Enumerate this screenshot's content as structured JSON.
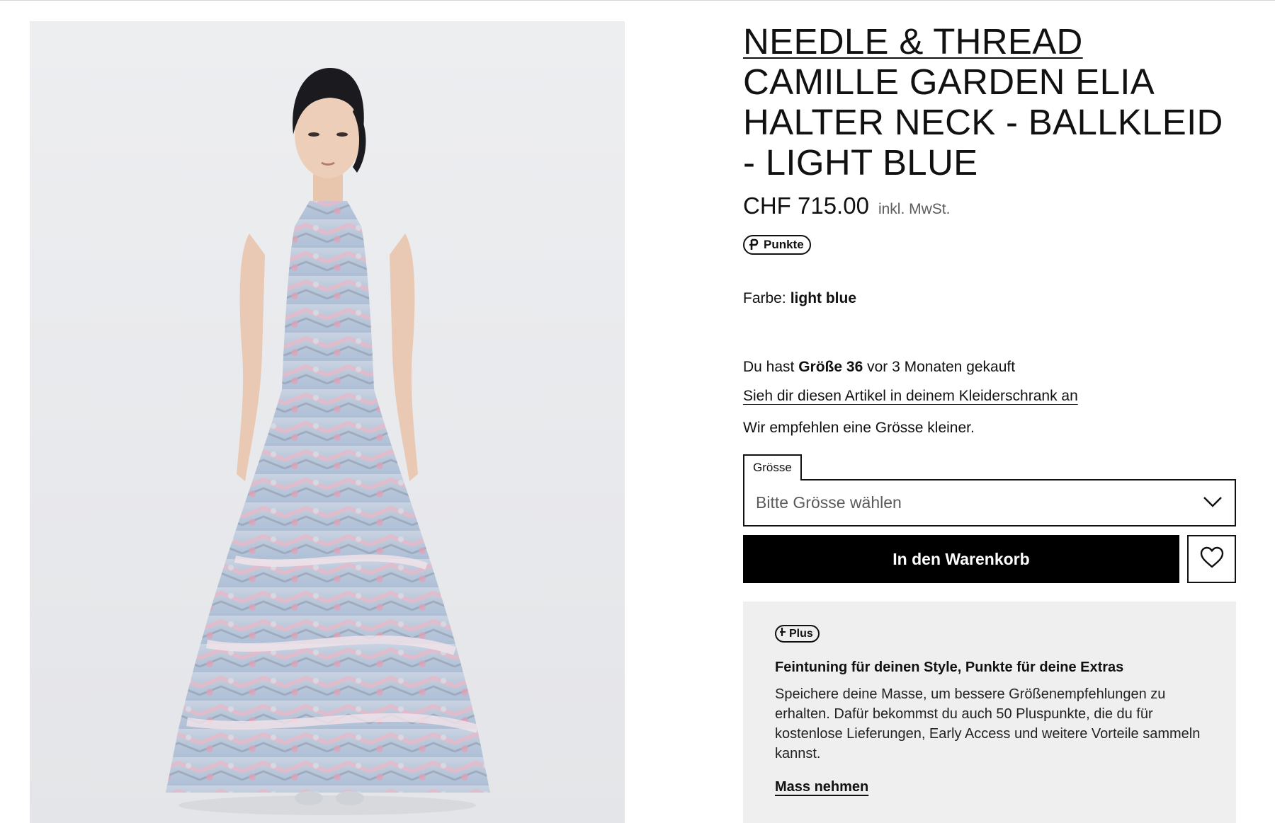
{
  "product": {
    "brand": "NEEDLE & THREAD",
    "name": "CAMILLE GARDEN ELIA HALTER NECK - BALLKLEID - LIGHT BLUE",
    "price": "CHF 715.00",
    "vat_note": "inkl. MwSt.",
    "points_badge": "Punkte",
    "image_alt": "Model wearing light blue floral ruffled tulle halter neck gown"
  },
  "color": {
    "label": "Farbe:",
    "value": "light blue"
  },
  "purchase_history": {
    "prefix": "Du hast",
    "size": "Größe 36",
    "suffix": "vor 3 Monaten gekauft",
    "wardrobe_link": "Sieh dir diesen Artikel in deinem Kleiderschrank an",
    "recommendation": "Wir empfehlen eine Grösse kleiner."
  },
  "size_select": {
    "tab_label": "Grösse",
    "placeholder": "Bitte Grösse wählen"
  },
  "actions": {
    "add_to_cart": "In den Warenkorb",
    "wishlist_icon": "heart-icon"
  },
  "plus": {
    "badge": "Plus",
    "title": "Feintuning für deinen Style, Punkte für deine Extras",
    "text": "Speichere deine Masse, um bessere Größenempfehlungen zu erhalten. Dafür bekommst du auch 50 Pluspunkte, die du für kostenlose Lieferungen, Early Access und weitere Vorteile sammeln kannst.",
    "link": "Mass nehmen"
  },
  "colors": {
    "primary": "#000000",
    "panel_bg": "#efefef",
    "text": "#111111",
    "muted": "#5c5c5c"
  }
}
